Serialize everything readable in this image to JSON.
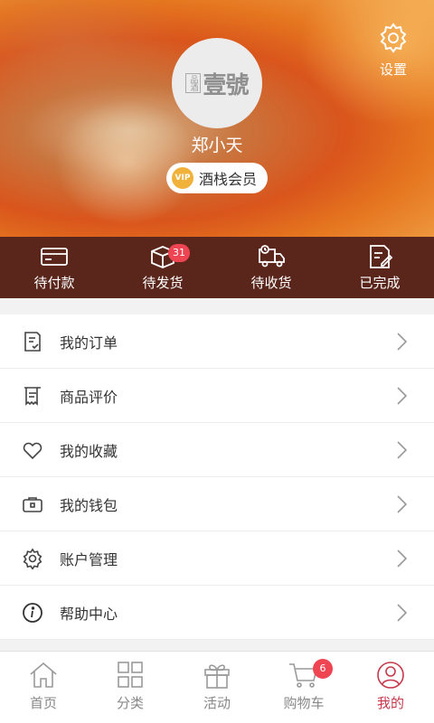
{
  "header": {
    "settings_label": "设置",
    "username": "郑小天",
    "vip_badge": "VIP",
    "member_level": "酒栈会员",
    "avatar_logo": "壹號",
    "avatar_logo_side": "品酒"
  },
  "orders": [
    {
      "label": "待付款",
      "icon": "wallet-card-icon"
    },
    {
      "label": "待发货",
      "icon": "package-box-icon",
      "badge": "31"
    },
    {
      "label": "待收货",
      "icon": "delivery-truck-icon"
    },
    {
      "label": "已完成",
      "icon": "completed-document-icon"
    }
  ],
  "menu": [
    {
      "label": "我的订单",
      "icon": "order-list-icon"
    },
    {
      "label": "商品评价",
      "icon": "review-receipt-icon"
    },
    {
      "label": "我的收藏",
      "icon": "heart-icon"
    },
    {
      "label": "我的钱包",
      "icon": "wallet-icon"
    },
    {
      "label": "账户管理",
      "icon": "gear-icon"
    },
    {
      "label": "帮助中心",
      "icon": "info-icon"
    }
  ],
  "tabbar": [
    {
      "label": "首页",
      "icon": "home-icon"
    },
    {
      "label": "分类",
      "icon": "grid-icon"
    },
    {
      "label": "活动",
      "icon": "gift-icon"
    },
    {
      "label": "购物车",
      "icon": "cart-icon",
      "badge": "6"
    },
    {
      "label": "我的",
      "icon": "user-icon",
      "active": true
    }
  ],
  "colors": {
    "order_bar": "#5a261c",
    "badge": "#ef4552",
    "active_tab": "#c6394b",
    "vip_gold": "#f0b23a"
  }
}
